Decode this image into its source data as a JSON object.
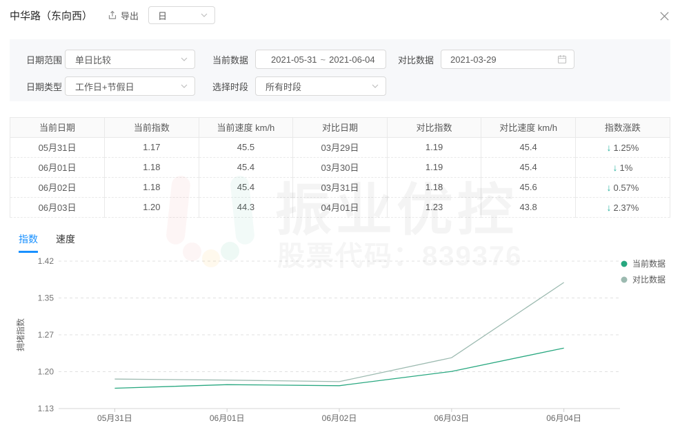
{
  "header": {
    "title": "中华路（东向西）",
    "export_label": "导出",
    "interval_value": "日"
  },
  "filters": {
    "row1": [
      {
        "label": "日期范围",
        "value": "单日比较"
      },
      {
        "label": "当前数据",
        "value": "2021-05-31",
        "separator": "~",
        "value2": "2021-06-04"
      },
      {
        "label": "对比数据",
        "value": "2021-03-29"
      }
    ],
    "row2": [
      {
        "label": "日期类型",
        "value": "工作日+节假日"
      },
      {
        "label": "选择时段",
        "value": "所有时段"
      }
    ]
  },
  "table": {
    "columns": [
      "当前日期",
      "当前指数",
      "当前速度 km/h",
      "对比日期",
      "对比指数",
      "对比速度 km/h",
      "指数涨跌"
    ],
    "rows": [
      {
        "cells": [
          "05月31日",
          "1.17",
          "45.5",
          "03月29日",
          "1.19",
          "45.4"
        ],
        "change": "1.25%",
        "direction": "down"
      },
      {
        "cells": [
          "06月01日",
          "1.18",
          "45.4",
          "03月30日",
          "1.19",
          "45.4"
        ],
        "change": "1%",
        "direction": "down"
      },
      {
        "cells": [
          "06月02日",
          "1.18",
          "45.4",
          "03月31日",
          "1.18",
          "45.6"
        ],
        "change": "0.57%",
        "direction": "down"
      },
      {
        "cells": [
          "06月03日",
          "1.20",
          "44.3",
          "04月01日",
          "1.23",
          "43.8"
        ],
        "change": "2.37%",
        "direction": "down"
      }
    ]
  },
  "tabs": [
    {
      "label": "指数",
      "active": true
    },
    {
      "label": "速度",
      "active": false
    }
  ],
  "chart_data": {
    "type": "line",
    "x_categories": [
      "05月31日",
      "06月01日",
      "06月02日",
      "06月03日",
      "06月04日"
    ],
    "series": [
      {
        "name": "当前数据",
        "color": "#27a77f",
        "values": [
          1.17,
          1.177,
          1.175,
          1.203,
          1.249
        ]
      },
      {
        "name": "对比数据",
        "color": "#9cbab0",
        "values": [
          1.188,
          1.186,
          1.183,
          1.23,
          1.378
        ]
      }
    ],
    "ylabel": "拥堵指数",
    "ylim": [
      1.13,
      1.42
    ],
    "ytick_labels": [
      "1.13",
      "1.20",
      "1.27",
      "1.35",
      "1.42"
    ],
    "grid": "horizontal-dashed",
    "legend_position": "right-top"
  },
  "watermark": {
    "title": "振业优控",
    "subtitle": "股票代码：839376"
  },
  "colors": {
    "accent_blue": "#1890ff",
    "current_series": "#27a77f",
    "compare_series": "#9cbab0",
    "down_arrow": "#2bb3a0"
  }
}
